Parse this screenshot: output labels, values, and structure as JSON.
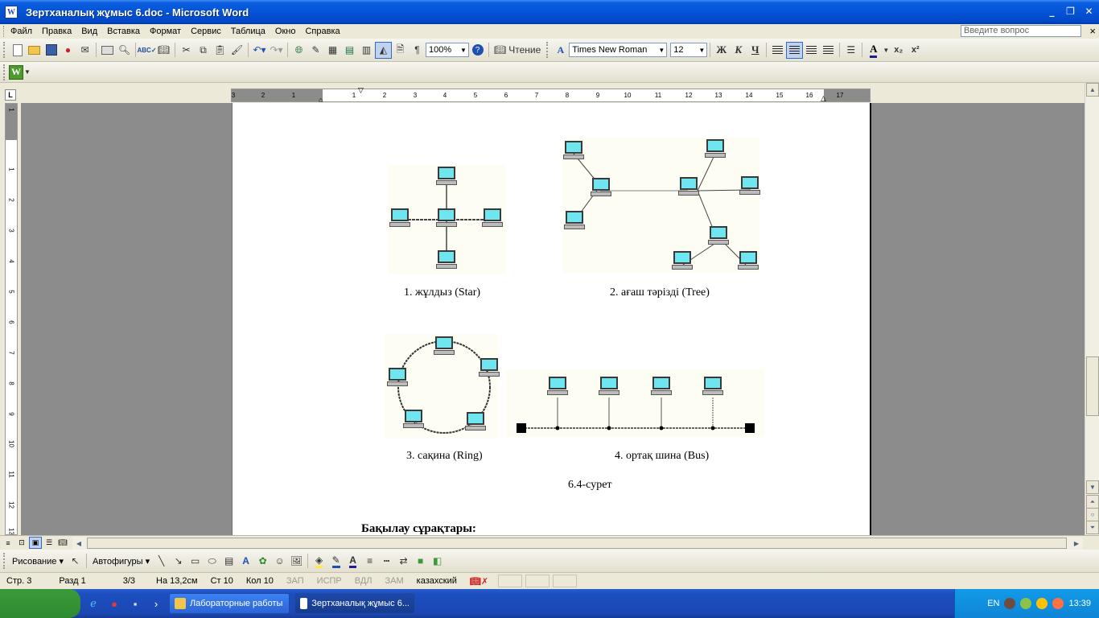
{
  "window": {
    "title": "Зертханалық жұмыс 6.doc - Microsoft Word",
    "app_icon_glyph": "W"
  },
  "menubar": {
    "items": [
      "Файл",
      "Правка",
      "Вид",
      "Вставка",
      "Формат",
      "Сервис",
      "Таблица",
      "Окно",
      "Справка"
    ],
    "question_placeholder": "Введите вопрос",
    "close_glyph": "×"
  },
  "toolbar": {
    "zoom": "100%",
    "reading_label": "Чтение",
    "font_name": "Times New Roman",
    "font_size": "12",
    "bold": "Ж",
    "italic": "К",
    "underline": "Ч",
    "pilcrow": "¶"
  },
  "ruler": {
    "tab_selector": "L",
    "h_labels": [
      "3",
      "2",
      "1",
      "1",
      "2",
      "3",
      "4",
      "5",
      "6",
      "7",
      "8",
      "9",
      "10",
      "11",
      "12",
      "13",
      "14",
      "15",
      "16",
      "17"
    ],
    "v_labels": [
      "1",
      "1",
      "2",
      "3",
      "4",
      "5",
      "6",
      "7",
      "8",
      "9",
      "10",
      "11",
      "12",
      "13"
    ]
  },
  "document": {
    "figures": [
      {
        "caption": "1. жұлдыз (Star)"
      },
      {
        "caption": "2. ағаш тәрізді (Tree)"
      },
      {
        "caption": "3. сақина (Ring)"
      },
      {
        "caption": "4. ортақ шина (Bus)"
      }
    ],
    "figure_label": "6.4-сурет",
    "next_heading": "Бақылау сұрақтары:"
  },
  "drawing_toolbar": {
    "draw_label": "Рисование ▾",
    "autoshapes_label": "Автофигуры ▾"
  },
  "statusbar": {
    "page": "Стр. 3",
    "section": "Разд 1",
    "page_of": "3/3",
    "at": "На 13,2см",
    "line": "Ст 10",
    "col": "Кол 10",
    "rec": "ЗАП",
    "trk": "ИСПР",
    "ext": "ВДЛ",
    "ovr": "ЗАМ",
    "language": "казахский"
  },
  "taskbar": {
    "tasks": [
      {
        "label": "Лабораторные работы"
      },
      {
        "label": "Зертханалық жұмыс 6..."
      }
    ],
    "lang": "EN",
    "clock": "13:39"
  },
  "colors": {
    "titlebar": "#0553d6",
    "screen": "#6fe6ef",
    "taskbar": "#1d4fc0",
    "tray": "#129be7"
  }
}
